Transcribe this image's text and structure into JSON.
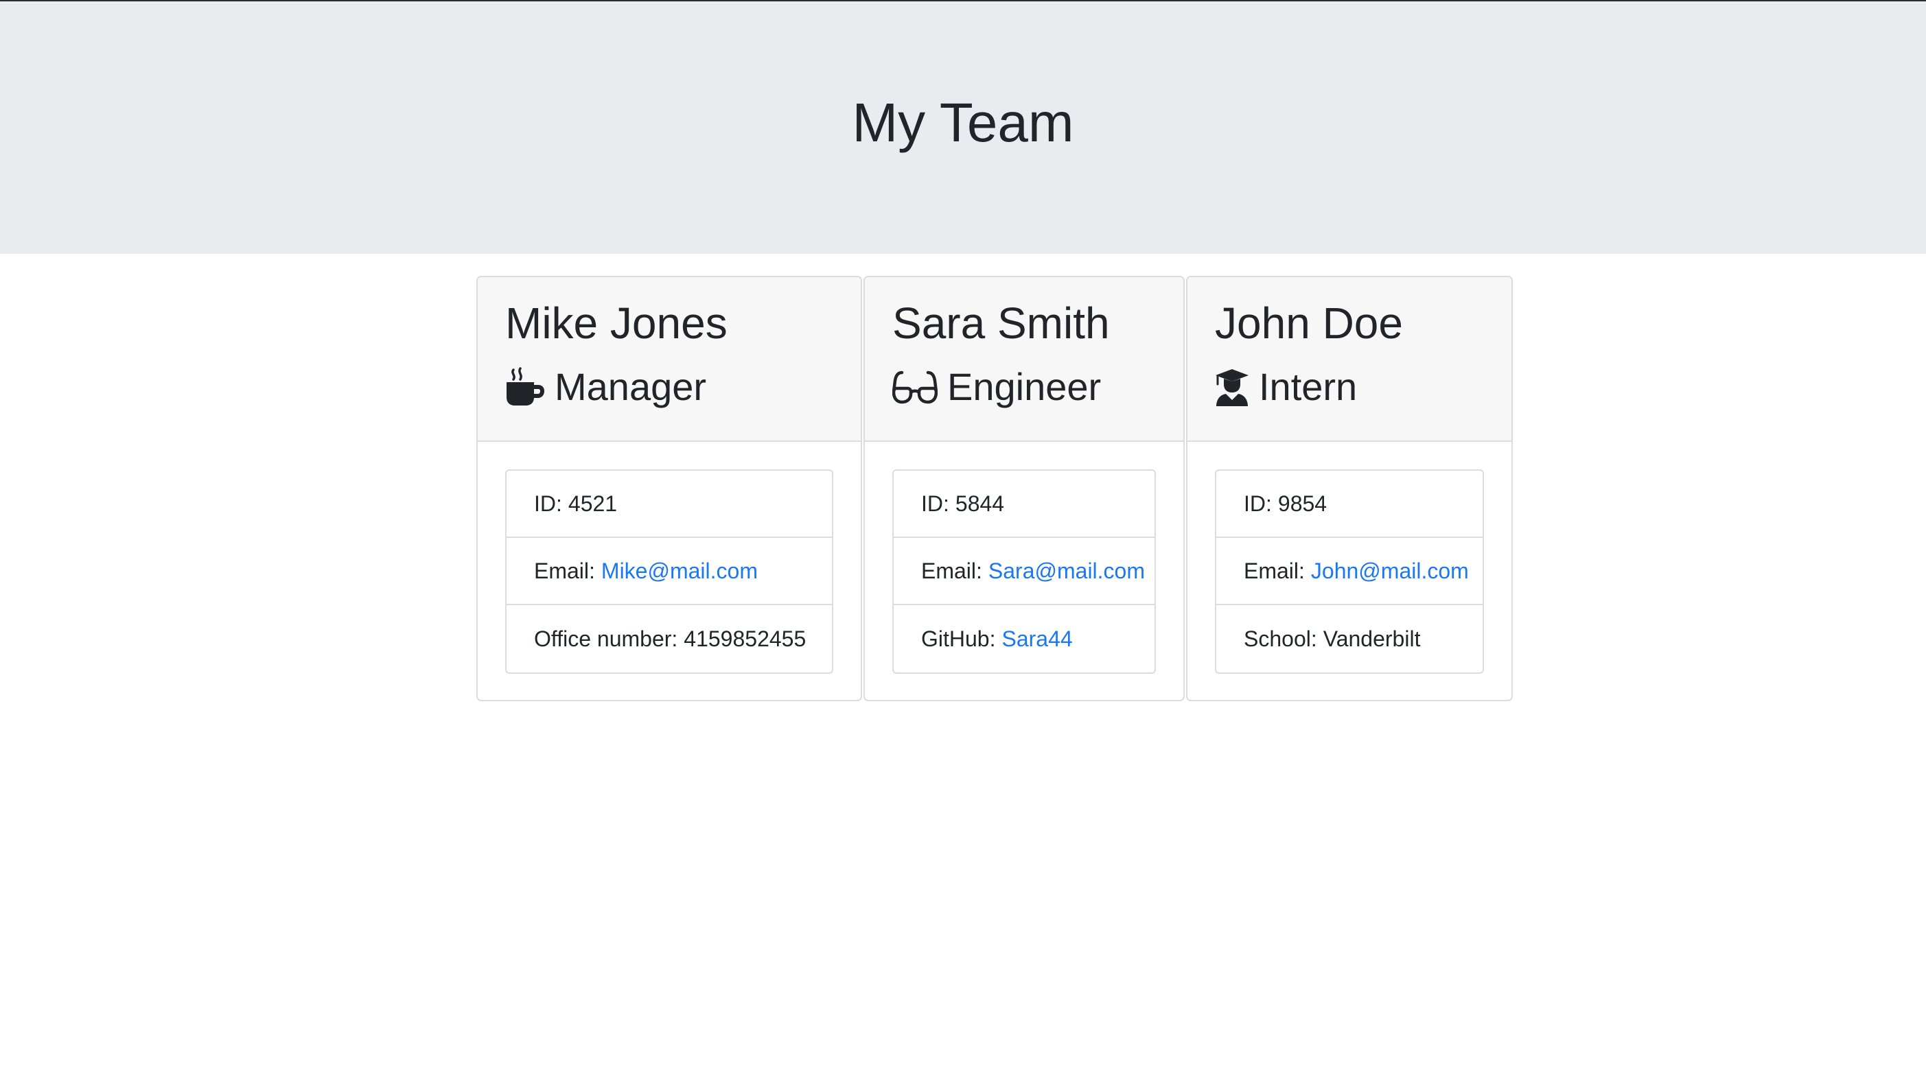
{
  "header": {
    "title": "My Team"
  },
  "colors": {
    "link": "#1a78f2",
    "jumbotron": "#e9ecef",
    "card_header": "#f7f7f7"
  },
  "employees": [
    {
      "name": "Mike Jones",
      "role": "Manager",
      "icon": "coffee-mug-icon",
      "id_label": "ID:",
      "id": "4521",
      "email_label": "Email:",
      "email": "Mike@mail.com",
      "extra_label": "Office number:",
      "extra_value": "4159852455"
    },
    {
      "name": "Sara Smith",
      "role": "Engineer",
      "icon": "glasses-icon",
      "id_label": "ID:",
      "id": "5844",
      "email_label": "Email:",
      "email": "Sara@mail.com",
      "extra_label": "GitHub:",
      "extra_value": "Sara44"
    },
    {
      "name": "John Doe",
      "role": "Intern",
      "icon": "graduate-icon",
      "id_label": "ID:",
      "id": "9854",
      "email_label": "Email:",
      "email": "John@mail.com",
      "extra_label": "School:",
      "extra_value": "Vanderbilt"
    }
  ]
}
